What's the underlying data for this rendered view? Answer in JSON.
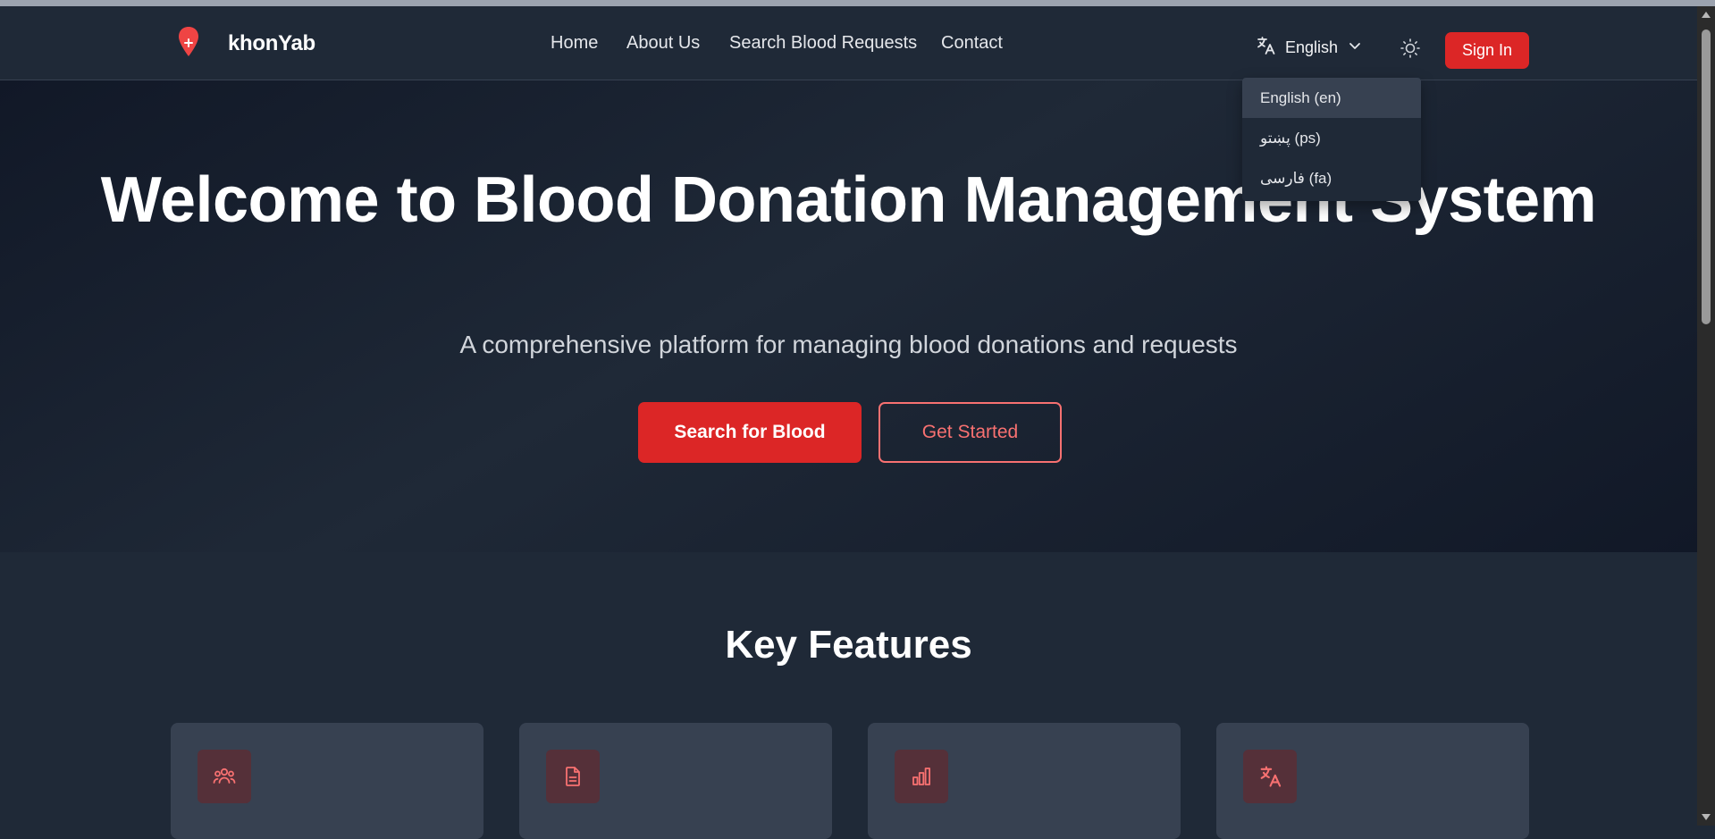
{
  "brand": {
    "name": "khonYab"
  },
  "nav": {
    "links": [
      {
        "label": "Home"
      },
      {
        "label": "About Us"
      },
      {
        "label": "Search Blood Requests"
      },
      {
        "label": "Contact"
      }
    ],
    "language_label": "English",
    "signin_label": "Sign In"
  },
  "language_menu": {
    "options": [
      {
        "label": "English (en)",
        "selected": true
      },
      {
        "label": "پښتو (ps)",
        "selected": false
      },
      {
        "label": "فارسی (fa)",
        "selected": false
      }
    ]
  },
  "hero": {
    "title": "Welcome to Blood Donation Management System",
    "subtitle": "A comprehensive platform for managing blood donations and requests",
    "primary_button": "Search for Blood",
    "secondary_button": "Get Started"
  },
  "features": {
    "title": "Key Features",
    "cards": [
      {
        "icon": "users-icon"
      },
      {
        "icon": "document-icon"
      },
      {
        "icon": "bar-chart-icon"
      },
      {
        "icon": "translate-icon"
      }
    ]
  },
  "colors": {
    "accent": "#dc2626",
    "accent_light": "#f87171",
    "background": "#1f2937",
    "card": "#374151"
  }
}
